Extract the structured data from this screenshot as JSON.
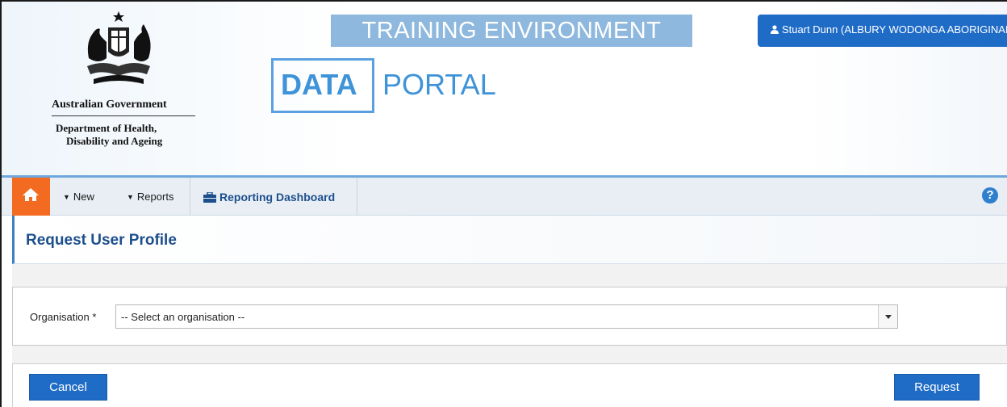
{
  "header": {
    "banner": "TRAINING ENVIRONMENT",
    "gov_name": "Australian Government",
    "dept_line1": "Department of Health,",
    "dept_line2": "Disability and Ageing",
    "portal_data": "DATA",
    "portal_text": "PORTAL",
    "user_label": "Stuart Dunn (ALBURY WODONGA ABORIGINAL HEALTH SERVICE)"
  },
  "nav": {
    "new_label": "New",
    "reports_label": "Reports",
    "dashboard_label": "Reporting Dashboard"
  },
  "page": {
    "title": "Request User Profile"
  },
  "form": {
    "org_label": "Organisation *",
    "org_value": "-- Select an organisation --"
  },
  "actions": {
    "cancel_label": "Cancel",
    "request_label": "Request"
  },
  "colors": {
    "accent": "#1f6cc7",
    "home": "#f26b21",
    "banner": "#8eb8dd",
    "title": "#1d4f8c"
  }
}
